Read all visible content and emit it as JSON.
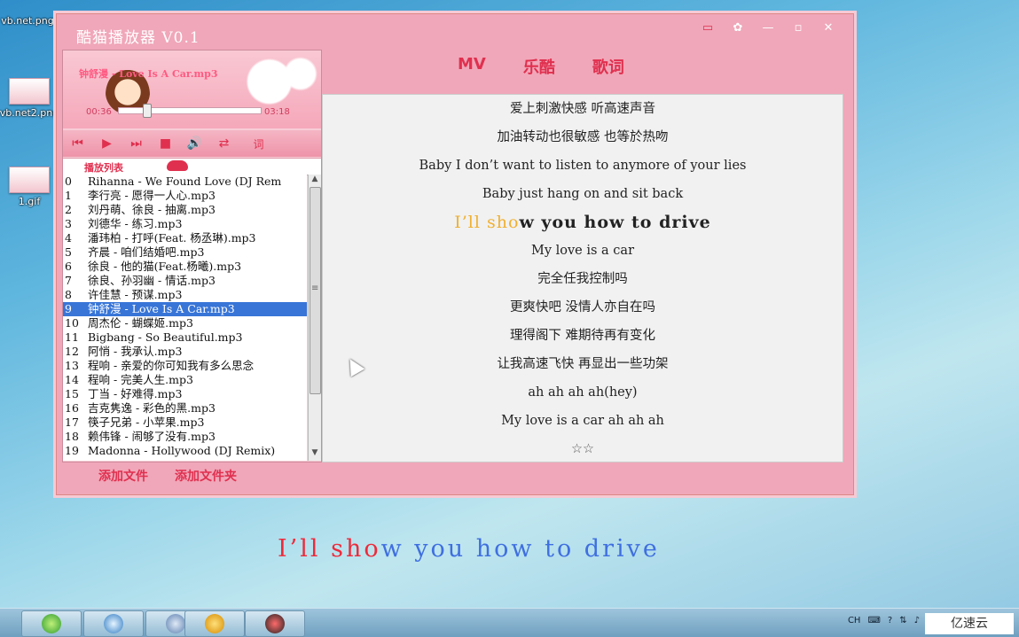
{
  "desktop": {
    "icons": [
      {
        "label": "vb.net.png"
      },
      {
        "label": "vb.net2.png"
      },
      {
        "label": "1.gif"
      }
    ]
  },
  "window": {
    "title": "酷猫播放器 V0.1",
    "buttons": {
      "mini": "▭",
      "skin": "✿",
      "minimize": "—",
      "maximize": "▫",
      "close": "✕"
    }
  },
  "player": {
    "now_playing": "钟舒漫 - Love Is A Car.mp3",
    "time_current": "00:36",
    "time_total": "03:18",
    "progress": 0.18,
    "controls": {
      "prev": "⏮",
      "play": "▶",
      "next": "⏭",
      "stop": "■",
      "volume": "🔊",
      "loop": "⇄",
      "lyric": "词"
    }
  },
  "playlist": {
    "label": "播放列表",
    "selected_index": 9,
    "items": [
      {
        "n": "0",
        "title": "Rihanna - We Found Love (DJ Rem"
      },
      {
        "n": "1",
        "title": "李行亮 - 愿得一人心.mp3"
      },
      {
        "n": "2",
        "title": "刘丹萌、徐良 - 抽离.mp3"
      },
      {
        "n": "3",
        "title": "刘德华 - 练习.mp3"
      },
      {
        "n": "4",
        "title": "潘玮柏 - 打呼(Feat. 杨丞琳).mp3"
      },
      {
        "n": "5",
        "title": "齐晨 - 咱们结婚吧.mp3"
      },
      {
        "n": "6",
        "title": "徐良 - 他的猫(Feat.杨曦).mp3"
      },
      {
        "n": "7",
        "title": "徐良、孙羽幽 - 情话.mp3"
      },
      {
        "n": "8",
        "title": "许佳慧 - 预谋.mp3"
      },
      {
        "n": "9",
        "title": "钟舒漫 - Love Is A Car.mp3"
      },
      {
        "n": "10",
        "title": "周杰伦 - 蝴蝶姬.mp3"
      },
      {
        "n": "11",
        "title": "Bigbang - So Beautiful.mp3"
      },
      {
        "n": "12",
        "title": "阿悄 - 我承认.mp3"
      },
      {
        "n": "13",
        "title": "程响 - 亲爱的你可知我有多么思念"
      },
      {
        "n": "14",
        "title": "程响 - 完美人生.mp3"
      },
      {
        "n": "15",
        "title": "丁当 - 好难得.mp3"
      },
      {
        "n": "16",
        "title": "吉克隽逸 - 彩色的黑.mp3"
      },
      {
        "n": "17",
        "title": "筷子兄弟 - 小苹果.mp3"
      },
      {
        "n": "18",
        "title": "赖伟锋 - 闹够了没有.mp3"
      },
      {
        "n": "19",
        "title": "Madonna - Hollywood (DJ Remix)"
      }
    ]
  },
  "bottom": {
    "add_file": "添加文件",
    "add_folder": "添加文件夹"
  },
  "tabs": [
    {
      "label": "MV"
    },
    {
      "label": "乐酷"
    },
    {
      "label": "歌词"
    }
  ],
  "lyrics": {
    "current_index": 4,
    "current_highlight": "I’ll sho",
    "current_rest": "w you how to drive",
    "lines": [
      "爱上刺激快感 听高速声音",
      "加油转动也很敏感 也等於热吻",
      "Baby I don’t want to listen to anymore of your lies",
      "Baby just hang on and sit back",
      "I’ll show you how to drive",
      "My love is a car",
      "完全任我控制吗",
      "更爽快吧 没情人亦自在吗",
      "理得阁下 难期待再有变化",
      "让我高速飞快 再显出一些功架",
      "ah ah ah ah(hey)",
      "My love is a car ah ah ah",
      "☆☆"
    ]
  },
  "desktop_lyric": {
    "played": "I’ll sho",
    "remaining": "w you how to drive"
  },
  "taskbar": {
    "tray_lang": "CH",
    "watermark": "亿速云"
  },
  "colors": {
    "accent": "#e0304f",
    "window_bg": "#f0a7b9",
    "selection": "#3875d7",
    "desktop_lyric_blue": "#3f6fe0",
    "desktop_lyric_red": "#ee2a3a",
    "lyric_highlight": "#f0b030"
  }
}
